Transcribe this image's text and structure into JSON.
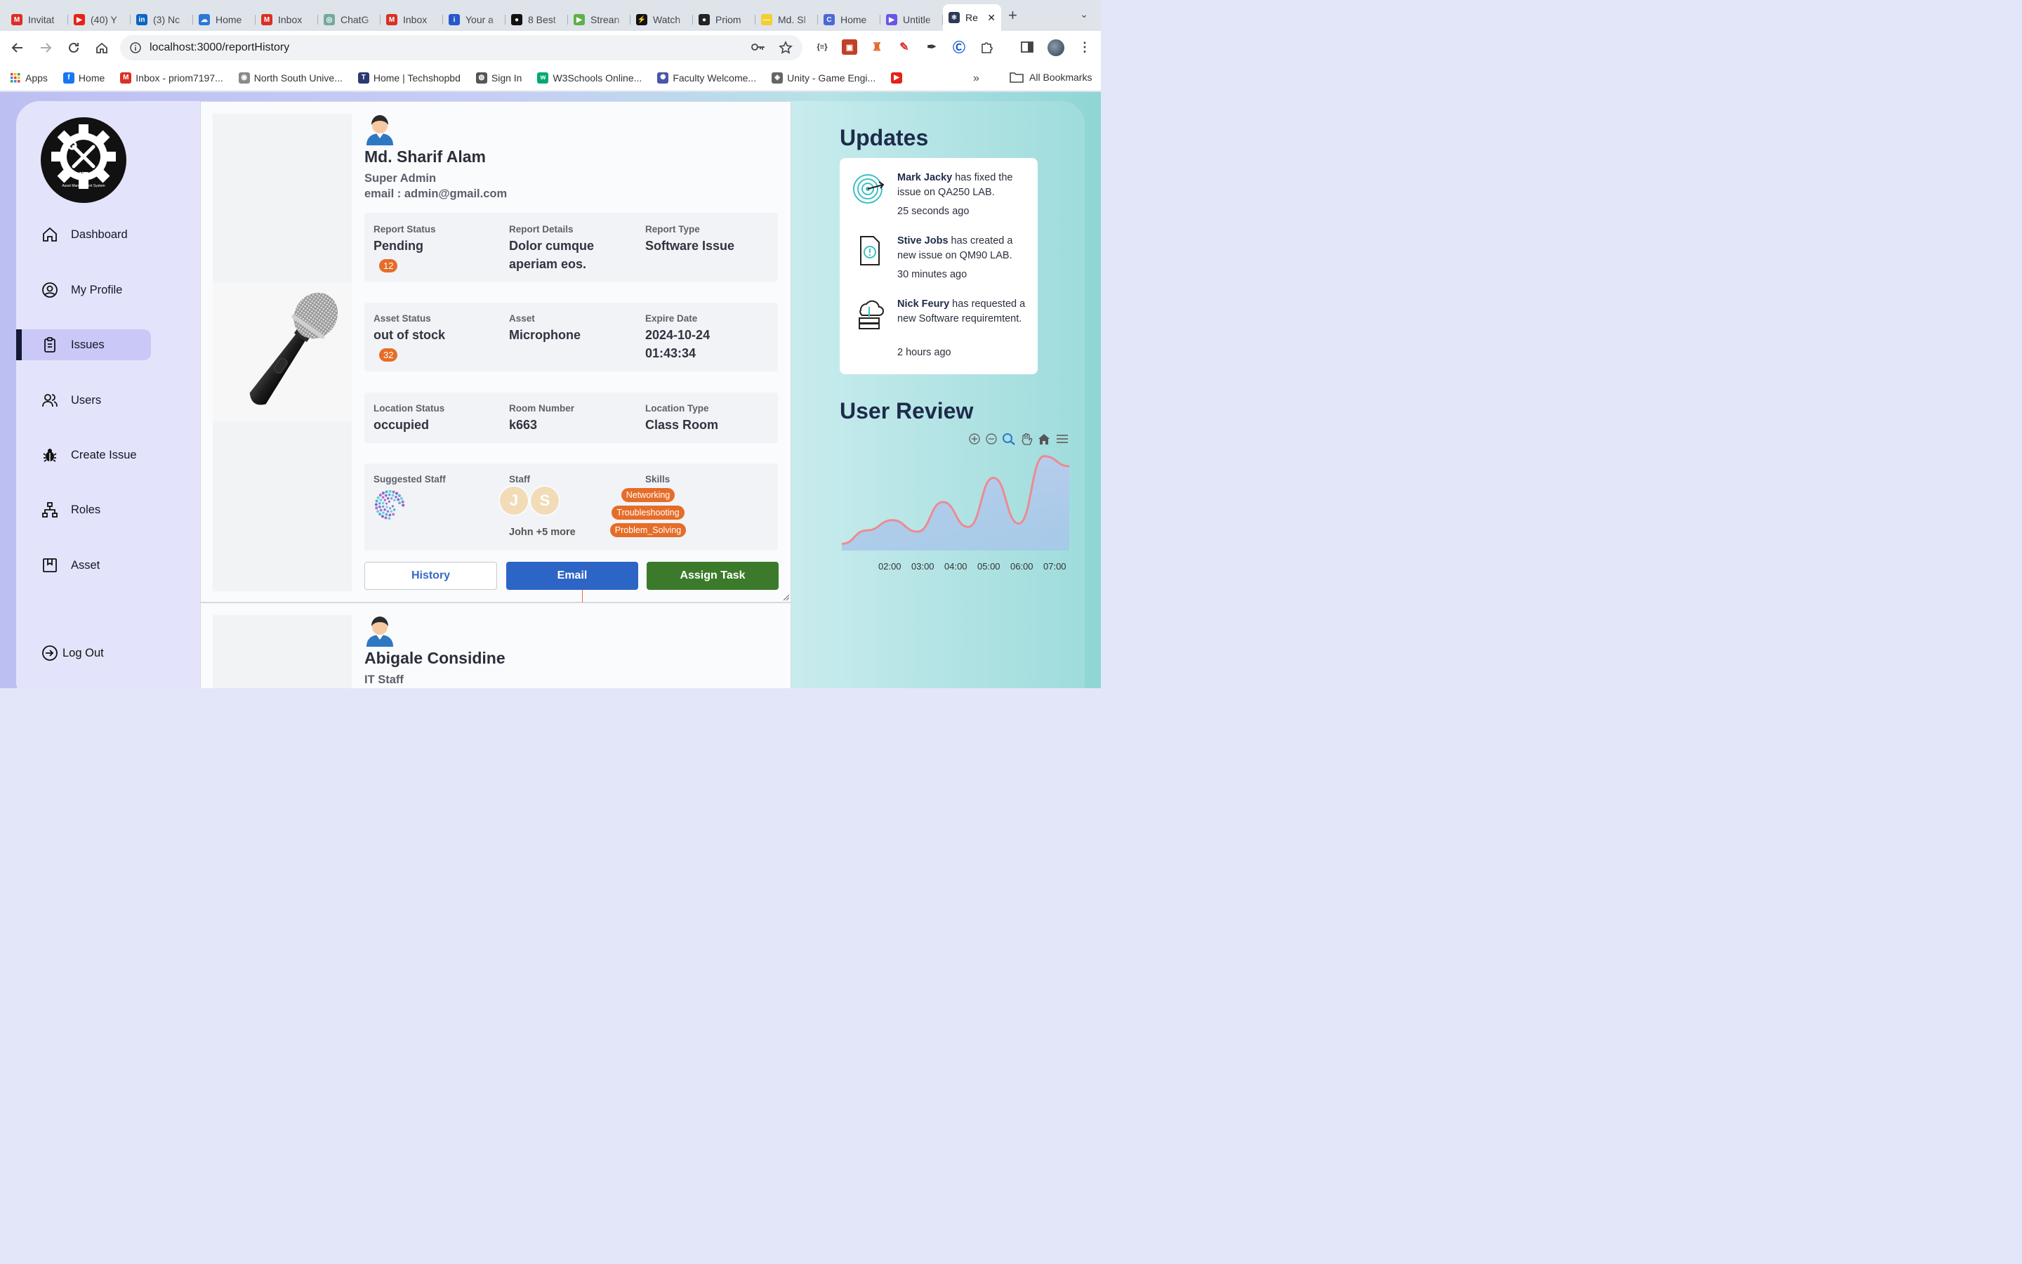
{
  "browser": {
    "tabs": [
      {
        "title": "Invitat",
        "icon": "gmail-icon",
        "color": "#d93025",
        "glyph": "M"
      },
      {
        "title": "(40) Y",
        "icon": "youtube-icon",
        "color": "#e62117",
        "glyph": "▶"
      },
      {
        "title": "(3) Nc",
        "icon": "linkedin-icon",
        "color": "#0a66c2",
        "glyph": "in"
      },
      {
        "title": "Home",
        "icon": "onedrive-icon",
        "color": "#2a78d6",
        "glyph": "☁"
      },
      {
        "title": "Inbox",
        "icon": "gmail-icon",
        "color": "#d93025",
        "glyph": "M"
      },
      {
        "title": "ChatG",
        "icon": "chatgpt-icon",
        "color": "#74aa9c",
        "glyph": "◎"
      },
      {
        "title": "Inbox",
        "icon": "gmail-icon",
        "color": "#d93025",
        "glyph": "M"
      },
      {
        "title": "Your a",
        "icon": "info-icon",
        "color": "#2857c9",
        "glyph": "i"
      },
      {
        "title": "8 Best",
        "icon": "medium-icon",
        "color": "#111111",
        "glyph": "●"
      },
      {
        "title": "Strean",
        "icon": "play-icon",
        "color": "#5fb04a",
        "glyph": "▶"
      },
      {
        "title": "Watch",
        "icon": "bolt-icon",
        "color": "#111111",
        "glyph": "⚡"
      },
      {
        "title": "Priom",
        "icon": "github-icon",
        "color": "#222222",
        "glyph": "●"
      },
      {
        "title": "Md. Sl",
        "icon": "note-icon",
        "color": "#f3cf2f",
        "glyph": "—"
      },
      {
        "title": "Home",
        "icon": "c-icon",
        "color": "#4c68d7",
        "glyph": "C"
      },
      {
        "title": "Untitle",
        "icon": "video-icon",
        "color": "#6a55e8",
        "glyph": "▶"
      },
      {
        "title": "Re",
        "icon": "react-icon",
        "color": "#2b3a55",
        "glyph": "⚛",
        "active": true
      }
    ],
    "url": "localhost:3000/reportHistory",
    "bookmarks": [
      {
        "label": "Apps",
        "icon": "apps-grid-icon",
        "color": "#ea4335"
      },
      {
        "label": "Home",
        "icon": "facebook-icon",
        "color": "#1877f2",
        "glyph": "f"
      },
      {
        "label": "Inbox - priom7197...",
        "icon": "gmail-icon",
        "color": "#d93025",
        "glyph": "M"
      },
      {
        "label": "North South Unive...",
        "icon": "nsu-icon",
        "color": "#8a8a8a",
        "glyph": "◉"
      },
      {
        "label": "Home | Techshopbd",
        "icon": "techshop-icon",
        "color": "#2b3a70",
        "glyph": "T"
      },
      {
        "label": "Sign In",
        "icon": "globe-icon",
        "color": "#555555",
        "glyph": "◍"
      },
      {
        "label": "W3Schools Online...",
        "icon": "w3schools-icon",
        "color": "#04aa6d",
        "glyph": "w"
      },
      {
        "label": "Faculty Welcome...",
        "icon": "faculty-icon",
        "color": "#4a56a6",
        "glyph": "✺"
      },
      {
        "label": "Unity - Game Engi...",
        "icon": "unity-icon",
        "color": "#666666",
        "glyph": "◈"
      },
      {
        "label": "",
        "icon": "youtube-icon",
        "color": "#e62117",
        "glyph": "▶"
      }
    ],
    "bookmarks_more": "»",
    "all_bookmarks": "All Bookmarks"
  },
  "sidebar": {
    "logo_title": "IT",
    "logo_subtitle": "Asset Management System",
    "items": [
      {
        "label": "Dashboard",
        "icon": "home-icon"
      },
      {
        "label": "My Profile",
        "icon": "user-circle-icon"
      },
      {
        "label": "Issues",
        "icon": "clipboard-icon",
        "active": true
      },
      {
        "label": "Users",
        "icon": "users-icon"
      },
      {
        "label": "Create Issue",
        "icon": "bug-icon"
      },
      {
        "label": "Roles",
        "icon": "hierarchy-icon"
      },
      {
        "label": "Asset",
        "icon": "bookmark-box-icon"
      }
    ],
    "logout": "Log Out"
  },
  "report": {
    "name": "Md. Sharif Alam",
    "role": "Super Admin",
    "email": "email : admin@gmail.com",
    "report_status_label": "Report Status",
    "report_status": "Pending",
    "report_badge": "12",
    "report_details_label": "Report Details",
    "report_details": "Dolor cumque aperiam eos.",
    "report_type_label": "Report Type",
    "report_type": "Software Issue",
    "asset_status_label": "Asset Status",
    "asset_status": "out of stock",
    "asset_badge": "32",
    "asset_label": "Asset",
    "asset": "Microphone",
    "expire_label": "Expire Date",
    "expire": "2024-10-24 01:43:34",
    "location_status_label": "Location Status",
    "location_status": "occupied",
    "room_label": "Room Number",
    "room": "k663",
    "location_type_label": "Location Type",
    "location_type": "Class Room",
    "suggested_staff_label": "Suggested Staff",
    "staff_label": "Staff",
    "staff_initials": [
      "J",
      "S"
    ],
    "staff_summary": "John +5 more",
    "skills_label": "Skills",
    "skills": [
      "Networking",
      "Troubleshooting",
      "Problem_Solving"
    ],
    "buttons": {
      "history": "History",
      "email": "Email",
      "assign": "Assign Task"
    },
    "badge_color": "#e66d28"
  },
  "report2": {
    "name": "Abigale Considine",
    "role": "IT Staff"
  },
  "updates": {
    "title": "Updates",
    "items": [
      {
        "name": "Mark Jacky",
        "text": " has fixed the issue on QA250 LAB.",
        "time": "25 seconds ago",
        "icon": "target-icon"
      },
      {
        "name": "Stive Jobs",
        "text": " has created a new issue on QM90 LAB.",
        "time": "30 minutes ago",
        "icon": "document-alert-icon"
      },
      {
        "name": "Nick Feury",
        "text": " has requested a new Software requiremtent.",
        "time": "2 hours ago",
        "icon": "cloud-server-icon"
      }
    ]
  },
  "review": {
    "title": "User Review",
    "toolbar_icons": [
      "zoom-in-icon",
      "zoom-out-icon",
      "zoom-select-icon",
      "pan-hand-icon",
      "reset-home-icon",
      "menu-icon"
    ]
  },
  "chart_data": {
    "type": "area",
    "title": "User Review",
    "x": [
      "01:30",
      "02:00",
      "02:30",
      "03:00",
      "03:30",
      "04:00",
      "04:30",
      "05:00",
      "05:30",
      "06:00",
      "06:30",
      "07:00",
      "07:30"
    ],
    "xticks": [
      "02:00",
      "03:00",
      "04:00",
      "05:00",
      "06:00",
      "07:00"
    ],
    "series": [
      {
        "values": [
          10,
          30,
          45,
          28,
          72,
          35,
          108,
          40,
          140,
          125
        ]
      }
    ],
    "ylim": [
      0,
      150
    ],
    "line_color": "#ee8a92",
    "fill_color": "#a9c8ec",
    "grid": false
  }
}
